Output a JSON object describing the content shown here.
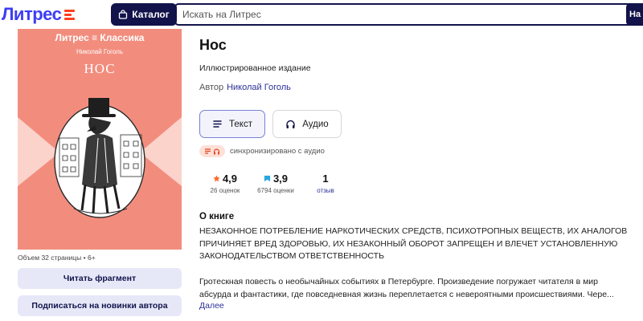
{
  "header": {
    "logo": "Литрес",
    "catalog_label": "Каталог",
    "search_placeholder": "Искать на Литрес",
    "search_button": "На"
  },
  "cover": {
    "brand": "Литрес ≡ Классика",
    "author": "Николай Гоголь",
    "title": "НОС",
    "background": "#f28d7e"
  },
  "sidebar": {
    "meta": "Объем 32 страницы   •   6+",
    "read_fragment": "Читать фрагмент",
    "subscribe": "Подписаться на новинки автора"
  },
  "book": {
    "title": "Нос",
    "edition": "Иллюстрированное издание",
    "author_label": "Автор",
    "author_name": "Николай Гоголь"
  },
  "formats": {
    "text": "Текст",
    "audio": "Аудио",
    "sync": "синхронизировано с аудио"
  },
  "stats": {
    "rating1": {
      "value": "4,9",
      "label": "26 оценок"
    },
    "rating2": {
      "value": "3,9",
      "label": "6794 оценки"
    },
    "reviews": {
      "value": "1",
      "label": "отзыв"
    }
  },
  "about": {
    "heading": "О книге",
    "warning_lines": [
      "НЕЗАКОННОЕ ПОТРЕБЛЕНИЕ НАРКОТИЧЕСКИХ СРЕДСТВ, ПСИХОТРОПНЫХ ВЕЩЕСТВ, ИХ АНАЛОГОВ",
      "ПРИЧИНЯЕТ ВРЕД ЗДОРОВЬЮ, ИХ НЕЗАКОННЫЙ ОБОРОТ ЗАПРЕЩЕН И ВЛЕЧЕТ УСТАНОВЛЕННУЮ",
      "ЗАКОНОДАТЕЛЬСТВОМ ОТВЕТСТВЕННОСТЬ"
    ],
    "description_lines": [
      "Гротескная повесть о необычайных событиях в Петербурге. Произведение погружает читателя в мир",
      "абсурда и фантастики, где повседневная жизнь переплетается с невероятными происшествиями. Чере..."
    ],
    "more": "Далее"
  },
  "colors": {
    "brand_blue": "#3d3df5",
    "brand_red": "#ff3d1f",
    "navy": "#12134a",
    "link": "#2c3196",
    "star": "#ff6a2b",
    "badge_blue": "#28a8e0"
  }
}
